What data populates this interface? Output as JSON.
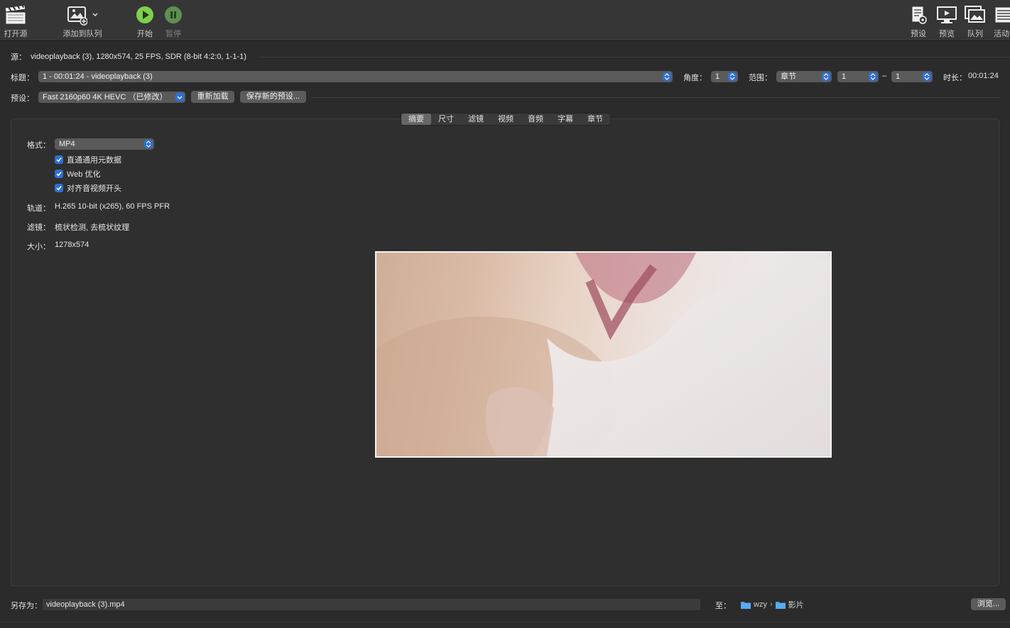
{
  "toolbar": {
    "open_source": "打开源",
    "add_queue": "添加到队列",
    "start": "开始",
    "pause": "暂停",
    "presets": "预设",
    "preview": "预览",
    "queue": "队列",
    "activity": "活动"
  },
  "source": {
    "label": "源：",
    "value": "videoplayback (3), 1280x574, 25 FPS, SDR (8-bit 4:2:0, 1-1-1)"
  },
  "title_row": {
    "title_label": "标题：",
    "title_value": "1 - 00:01:24 - videoplayback (3)",
    "angle_label": "角度：",
    "angle_value": "1",
    "range_label": "范围：",
    "range_type": "章节",
    "range_from": "1",
    "range_dash": "–",
    "range_to": "1",
    "duration_label": "时长：",
    "duration_value": "00:01:24"
  },
  "preset_row": {
    "label": "预设：",
    "value": "Fast 2160p60 4K HEVC （已修改）",
    "reload": "重新加载",
    "save_new": "保存新的预设..."
  },
  "tabs": [
    "摘要",
    "尺寸",
    "滤镜",
    "视频",
    "音频",
    "字幕",
    "章节"
  ],
  "summary": {
    "format_label": "格式：",
    "format_value": "MP4",
    "checkboxes": [
      "直通通用元数据",
      "Web 优化",
      "对齐音视频开头"
    ],
    "tracks_label": "轨道：",
    "tracks_value": "H.265 10-bit (x265), 60 FPS PFR",
    "filters_label": "滤镜：",
    "filters_value": "梳状检测, 去梳状纹理",
    "size_label": "大小：",
    "size_value": "1278x574"
  },
  "save_row": {
    "label": "另存为：",
    "filename": "videoplayback (3).mp4",
    "to_label": "至：",
    "path_user": "wzy",
    "path_sep": "›",
    "path_folder": "影片",
    "browse": "浏览..."
  },
  "colors": {
    "accent": "#2f6fd6",
    "start_green": "#7ed04b",
    "pause_green": "#5f8f52"
  }
}
